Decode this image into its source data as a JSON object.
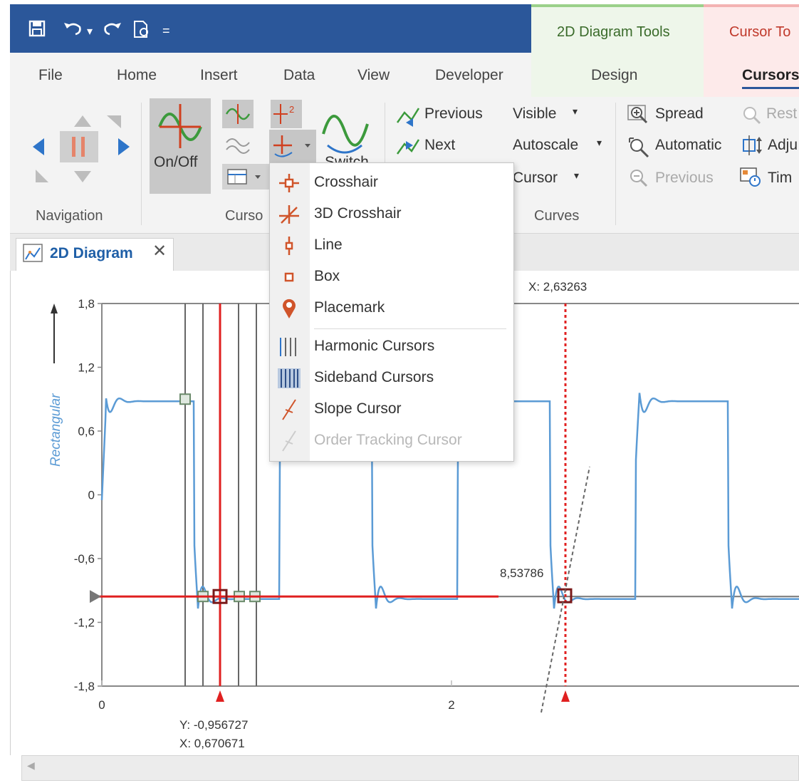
{
  "diagram_tools_label": "2D Diagram Tools",
  "cursor_tools_label": "Cursor To",
  "tabs": [
    "File",
    "Home",
    "Insert",
    "Data",
    "View",
    "Developer",
    "Design",
    "Cursors"
  ],
  "ribbon": {
    "navigation_label": "Navigation",
    "cursor_group_label": "Curso",
    "curves_label": "Curves",
    "onoff_label": "On/Off",
    "switch_label": "Switch",
    "previous": "Previous",
    "next": "Next",
    "visible": "Visible",
    "autoscale": "Autoscale",
    "cursor": "Cursor",
    "spread": "Spread",
    "automatic": "Automatic",
    "zoom_previous": "Previous",
    "reset": "Rest",
    "adjust": "Adju",
    "time": "Tim"
  },
  "doc_tab": {
    "label": "2D Diagram"
  },
  "menu": {
    "items": [
      {
        "label": "Crosshair",
        "icon": "crosshair-icon",
        "enabled": true
      },
      {
        "label": "3D Crosshair",
        "icon": "3d-crosshair-icon",
        "enabled": true
      },
      {
        "label": "Line",
        "icon": "line-cursor-icon",
        "enabled": true
      },
      {
        "label": "Box",
        "icon": "box-cursor-icon",
        "enabled": true
      },
      {
        "label": "Placemark",
        "icon": "placemark-icon",
        "enabled": true
      },
      {
        "label": "Harmonic Cursors",
        "icon": "harmonic-cursors-icon",
        "enabled": true
      },
      {
        "label": "Sideband Cursors",
        "icon": "sideband-cursors-icon",
        "enabled": true
      },
      {
        "label": "Slope Cursor",
        "icon": "slope-cursor-icon",
        "enabled": true
      },
      {
        "label": "Order Tracking Cursor",
        "icon": "order-tracking-cursor-icon",
        "enabled": false
      }
    ]
  },
  "chart_data": {
    "type": "line",
    "ylabel": "Rectangular",
    "ylim": [
      -1.8,
      1.8
    ],
    "yticks": [
      "1,8",
      "1,2",
      "0,6",
      "0",
      "-0,6",
      "-1,2",
      "-1,8"
    ],
    "xticks": [
      "0",
      "2"
    ],
    "series": [
      {
        "color": "#5b9bd5"
      }
    ],
    "cursor_readouts": {
      "crosshair_y": "Y: -0,956727",
      "crosshair_x": "X: 0,670671",
      "right_cursor_x": "X: 2,63263",
      "right_cursor_value": "8,53786"
    }
  },
  "colors": {
    "accent": "#2b579a",
    "cursor": "#e02020",
    "curve": "#5b9bd5"
  }
}
